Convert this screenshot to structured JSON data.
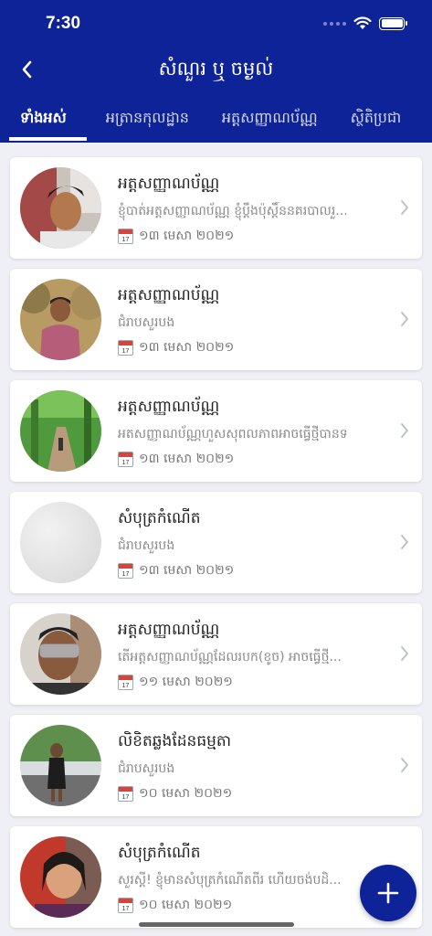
{
  "status_bar": {
    "time": "7:30"
  },
  "header": {
    "title": "សំណួរ ឬ ចម្ងល់"
  },
  "tabs": [
    {
      "label": "ទាំងអស់",
      "active": true
    },
    {
      "label": "អត្រានកុលដ្ឋាន",
      "active": false
    },
    {
      "label": "អត្តសញ្ញាណប័ណ្ណ",
      "active": false
    },
    {
      "label": "ស្ថិតិប្រជា",
      "active": false
    }
  ],
  "items": [
    {
      "title": "អត្តសញ្ញាណប័ណ្ណ",
      "desc": "ខ្ញុំបាត់អត្តសញ្ញាណប័ណ្ណ ខ្ញុំប្តឹងប៉ុស្តិ៍ននគរបាលរួ...",
      "date": "១៣ មេសា ២០២១"
    },
    {
      "title": "អត្តសញ្ញាណប័ណ្ណ",
      "desc": "ជំរាបសួរបង",
      "date": "១៣ មេសា ២០២១"
    },
    {
      "title": "អត្តសញ្ញាណប័ណ្ណ",
      "desc": "អតសញ្ញាណប័ណ្ណហួសសុពលភាពអាចធ្វើថ្មីបានទ",
      "date": "១៣ មេសា ២០២១"
    },
    {
      "title": "សំបុត្រកំណើត",
      "desc": "ជំរាបសួរបង",
      "date": "១៣ មេសា ២០២១"
    },
    {
      "title": "អត្តសញ្ញាណប័ណ្ណ",
      "desc": "តើអត្តសញ្ញាណប័ណ្ណដែលរបក(ខូច) អាចធ្វើថ្មី...",
      "date": "១១ មេសា ២០២១"
    },
    {
      "title": "លិខិតឆ្លងដែនធម្មតា",
      "desc": "ជំរាបសួរបង",
      "date": "១០ មេសា ២០២១"
    },
    {
      "title": "សំបុត្រកំណើត",
      "desc": "សួរស្តី! ខ្ញុំមានសំបុត្រកំណើតពីរ ហើយចង់បដិ...",
      "date": "១០ មេសា ២០២១"
    }
  ],
  "calendar_icon_text": "17",
  "colors": {
    "primary": "#0f2399",
    "background": "#eef0f5"
  }
}
